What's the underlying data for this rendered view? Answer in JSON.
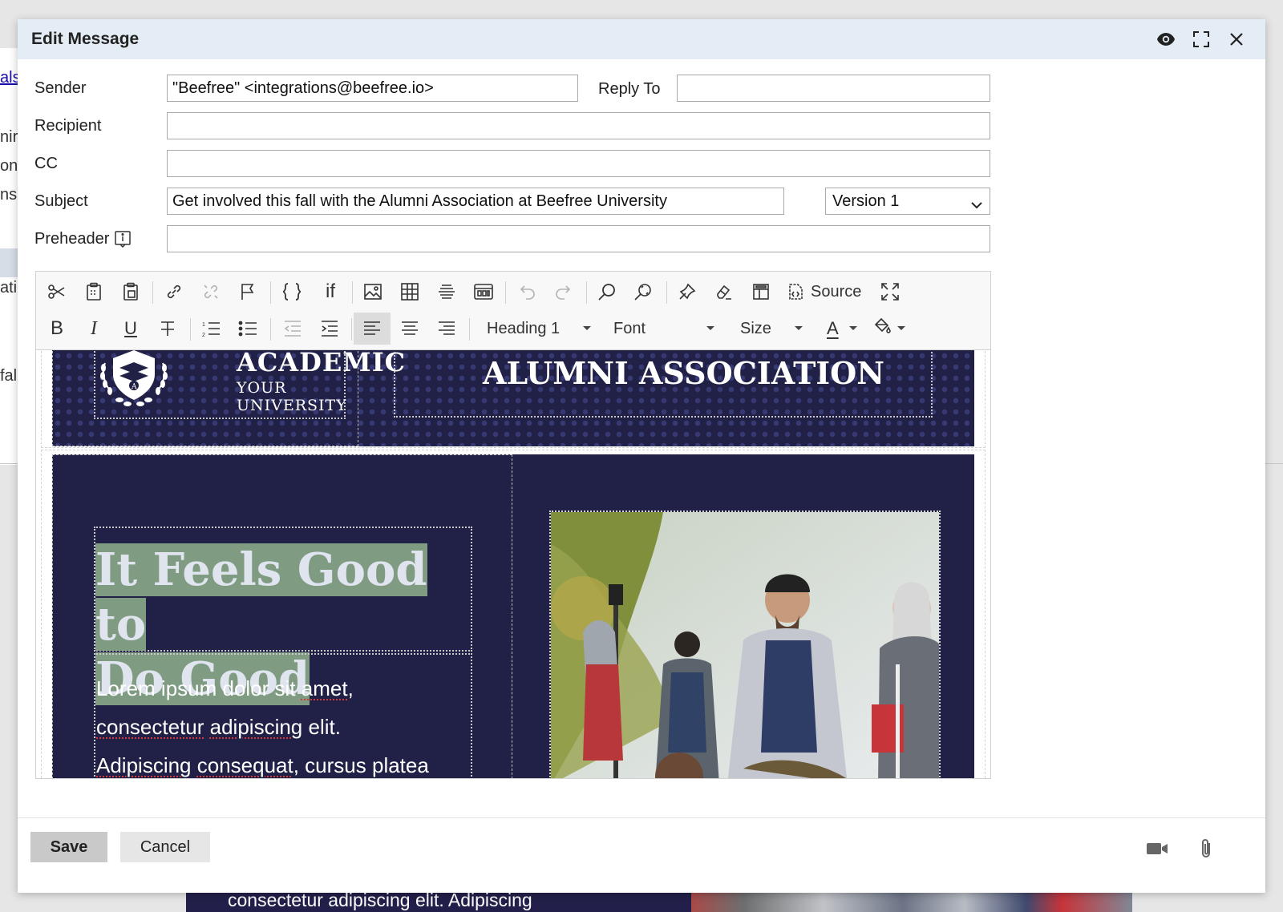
{
  "background": {
    "fragments": [
      "alsh",
      "nir",
      "on",
      "nsu",
      "ati",
      "fall"
    ],
    "bottom_text": "consectetur adipiscing elit. Adipiscing"
  },
  "dialog": {
    "title": "Edit Message",
    "header_icons": [
      "eye-icon",
      "maximize-icon",
      "close-icon"
    ]
  },
  "form": {
    "sender_label": "Sender",
    "sender_value": "\"Beefree\" <integrations@beefree.io>",
    "reply_to_label": "Reply To",
    "reply_to_value": "",
    "recipient_label": "Recipient",
    "recipient_value": "",
    "cc_label": "CC",
    "cc_value": "",
    "subject_label": "Subject",
    "subject_value": "Get involved this fall with the Alumni Association at Beefree University",
    "version_selected": "Version 1",
    "preheader_label": "Preheader",
    "preheader_value": ""
  },
  "toolbar": {
    "source_label": "Source",
    "format_combo": "Heading 1",
    "font_combo": "Font",
    "size_combo": "Size",
    "bold": "B",
    "italic": "I",
    "underline": "U",
    "text_color_letter": "A"
  },
  "email": {
    "logo_title": "ACADEMIC",
    "logo_subtitle": "YOUR UNIVERSITY",
    "banner_title": "ALUMNI ASSOCIATION",
    "headline_line1": "It Feels Good to",
    "headline_line2": "Do Good",
    "body_line1_a": "Lorem ipsum dolor sit ",
    "body_line1_b": "amet",
    "body_line1_c": ",",
    "body_line2_a": "consectetur",
    "body_line2_b": "adipiscing",
    "body_line2_c": " elit.",
    "body_line3_a": "Adipiscing",
    "body_line3_b": "consequat",
    "body_line3_c": ", cursus platea"
  },
  "footer": {
    "save_label": "Save",
    "cancel_label": "Cancel",
    "icons": [
      "video-icon",
      "attachment-icon"
    ]
  },
  "colors": {
    "header_bg": "#e4edf5",
    "email_navy": "#212046",
    "headline_highlight": "#7f9c83"
  }
}
